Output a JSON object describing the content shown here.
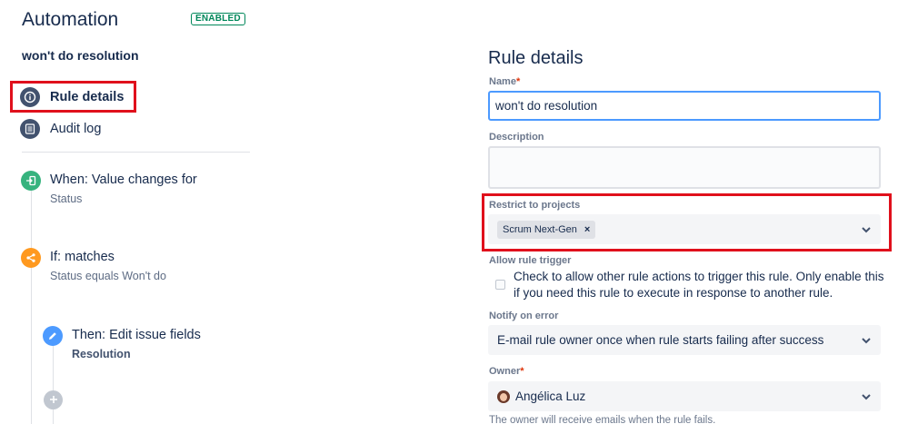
{
  "header": {
    "title": "Automation",
    "status": "ENABLED",
    "rule_name": "won't do resolution"
  },
  "nav": {
    "rule_details": "Rule details",
    "audit_log": "Audit log"
  },
  "flow": {
    "when": {
      "title": "When: Value changes for",
      "subtitle": "Status"
    },
    "if": {
      "title": "If: matches",
      "subtitle": "Status equals Won't do"
    },
    "then": {
      "title": "Then: Edit issue fields",
      "subtitle": "Resolution"
    }
  },
  "panel": {
    "title": "Rule details",
    "name_label": "Name",
    "name_value": "won't do resolution",
    "required_mark": "*",
    "description_label": "Description",
    "description_value": "",
    "restrict_label": "Restrict to projects",
    "restrict_tag": "Scrum Next-Gen",
    "tag_remove": "×",
    "allow_label": "Allow rule trigger",
    "allow_text": "Check to allow other rule actions to trigger this rule. Only enable this if you need this rule to execute in response to another rule.",
    "allow_checked": false,
    "notify_label": "Notify on error",
    "notify_value": "E-mail rule owner once when rule starts failing after success",
    "owner_label": "Owner",
    "owner_value": "Angélica Luz",
    "owner_hint": "The owner will receive emails when the rule fails."
  },
  "colors": {
    "enabled": "#00875a",
    "highlight": "#e0101c",
    "when_icon": "#36b37e",
    "if_icon": "#ff991f",
    "then_icon": "#4c9aff"
  },
  "icons": {
    "rule_details": "info-icon",
    "audit_log": "list-icon",
    "when": "trigger-icon",
    "if": "branch-icon",
    "then": "pencil-icon",
    "add": "plus-icon",
    "select": "chevron-down-icon"
  }
}
